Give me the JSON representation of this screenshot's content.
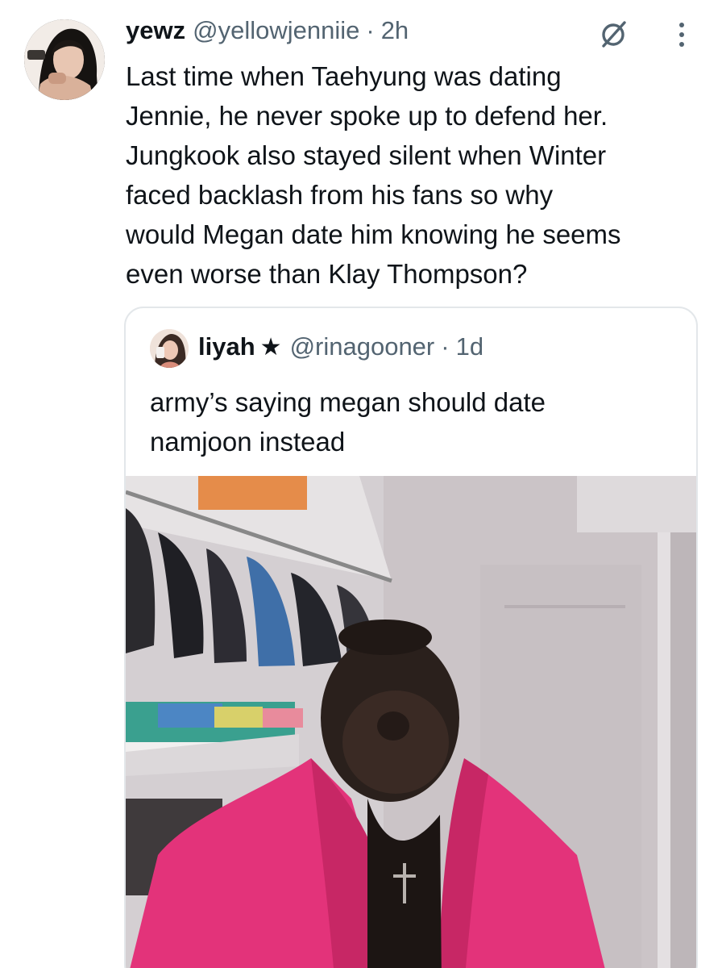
{
  "tweet": {
    "author": {
      "display_name": "yewz",
      "handle": "@yellowjenniie",
      "separator": "·",
      "time": "2h"
    },
    "text_lines": [
      "Last time when Taehyung was dating",
      "Jennie, he never spoke up to defend her.",
      "Jungkook also stayed silent when Winter",
      "faced backlash from his fans so why",
      "would Megan date him knowing he seems",
      "even worse than Klay Thompson?"
    ],
    "icons": {
      "grok": "grok-slash-circle-icon",
      "more": "more-vertical-icon"
    }
  },
  "quote": {
    "author": {
      "display_name": "liyah",
      "star": "★",
      "handle": "@rinagooner",
      "separator": "·",
      "time": "1d"
    },
    "text_lines": [
      "army’s saying megan should date",
      "namjoon instead"
    ],
    "media": {
      "kind": "video-still",
      "icon": "video-media"
    }
  },
  "colors": {
    "text": "#0f1419",
    "secondary": "#536471",
    "border": "#e3e7ea",
    "background": "#ffffff"
  }
}
